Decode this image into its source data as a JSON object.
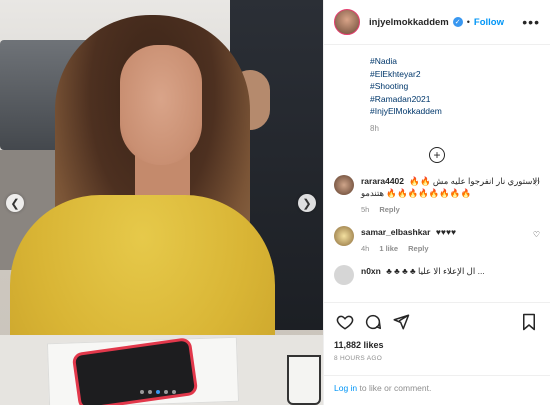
{
  "post": {
    "username": "injyelmokkaddem",
    "separator": "•",
    "follow_label": "Follow",
    "more_label": "•••",
    "hashtags": [
      "#Nadia",
      "#ElEkhteyar2",
      "#Shooting",
      "#Ramadan2021",
      "#InjyElMokkaddem"
    ],
    "caption_time": "8h",
    "load_more": "+"
  },
  "comments": [
    {
      "user": "rarara4402",
      "text": "الاستوري نار انفرجوا عليه مش 🔥🔥🔥🔥🔥🔥🔥🔥🔥🔥 هتندمو",
      "time": "5h",
      "likes": "",
      "reply": "Reply"
    },
    {
      "user": "samar_elbashkar",
      "text": "♥♥♥♥",
      "time": "4h",
      "likes": "1 like",
      "reply": "Reply"
    }
  ],
  "partial_comment": {
    "user": "n0xn",
    "text": "♣ ♣ ♣ ♣  ال الإعلاء الا عليا ..."
  },
  "actions": {
    "likes_count": "11,882 likes",
    "time_ago": "8 HOURS AGO"
  },
  "login": {
    "link": "Log in",
    "rest": " to like or comment."
  },
  "colors": {
    "link": "#0095f6",
    "hashtag": "#00376b",
    "verified": "#3897f0",
    "sweater": "#d9b535"
  },
  "icons": {
    "prev": "chevron-left-icon",
    "next": "chevron-right-icon",
    "like": "heart-icon",
    "comment": "comment-icon",
    "share": "paper-plane-icon",
    "save": "bookmark-icon"
  }
}
